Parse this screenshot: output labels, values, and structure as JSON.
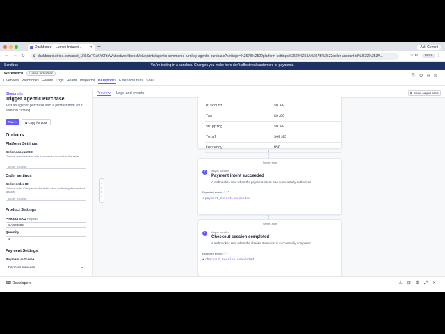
{
  "browser": {
    "tab_title": "Dashboard – Lumen Industri...",
    "new_tab": "+",
    "ask_gemini": "Ask Gemini",
    "url": "dashboard.stripe.com/acct_1RLCnTCuKY9FtoWn/test/workbench/blueprints/agentic-commerce-turnkey-agentic-purchase?settings=%257B%2522platform-settings%2522%253A%257B%2522seller-account-id%2522%253A...",
    "profile": "Work"
  },
  "sandbox": {
    "label": "Sandbox",
    "message": "You're testing in a sandbox. Changes you make here don't affect real customers or payments."
  },
  "header": {
    "app": "Workbench",
    "account": "Lumen Industries",
    "tabs": [
      "Overview",
      "Webhooks",
      "Events",
      "Logs",
      "Health",
      "Inspector",
      "Blueprints",
      "Extension runs",
      "Shell"
    ],
    "active_tab": "Blueprints"
  },
  "left": {
    "breadcrumb": "Blueprints",
    "title": "Trigger Agentic Purchase",
    "description": "Test an agentic purchase with a product from your external catalog.",
    "run_label": "Run",
    "copy_label": "Copy for LLM",
    "options_heading": "Options",
    "platform_heading": "Platform Settings",
    "seller_account_label": "Seller account ID",
    "seller_account_help": "Optional override to test with a connected account as the seller.",
    "seller_account_placeholder": "Enter a value",
    "order_heading": "Order settings",
    "seller_order_label": "Seller order ID",
    "seller_order_help": "Optional order ID to pass to the seller when confirming the checkout session.",
    "seller_order_placeholder": "Enter a value",
    "product_heading": "Product Settings",
    "sku_label": "Product SKU",
    "sku_required": "Required",
    "sku_value": "CAS00002",
    "quantity_label": "Quantity",
    "quantity_value": "1",
    "payment_heading": "Payment Settings",
    "payment_outcome_label": "Payment outcome",
    "payment_outcome_value": "Payment succeeds"
  },
  "right": {
    "tabs": [
      "Preview",
      "Logs and events"
    ],
    "show_output": "Show output pane",
    "summary_rows": [
      {
        "label": "Discount",
        "value": "$0.00"
      },
      {
        "label": "Tax",
        "value": "$0.00"
      },
      {
        "label": "Shipping",
        "value": "$0.00"
      },
      {
        "label": "Total",
        "value": "$49.95"
      },
      {
        "label": "Currency",
        "value": "USD"
      }
    ],
    "card1": {
      "side": "Server-side",
      "kind": "Async handler",
      "title": "Payment intent succeeded",
      "desc": "A webhook is sent when the payment intent was successfully authorized",
      "events_label": "Expected events",
      "event": "payment_intent.succeeded"
    },
    "card2": {
      "side": "Server-side",
      "kind": "Async handler",
      "title": "Checkout session completed",
      "desc": "A webhook is sent when the checkout session is successfully completed",
      "events_label": "Expected events",
      "event": "checkout.session.completed"
    }
  },
  "bottom": {
    "developers": "Developers"
  },
  "colors": {
    "accent": "#635bff",
    "sandbox_bar": "#1f3264"
  }
}
